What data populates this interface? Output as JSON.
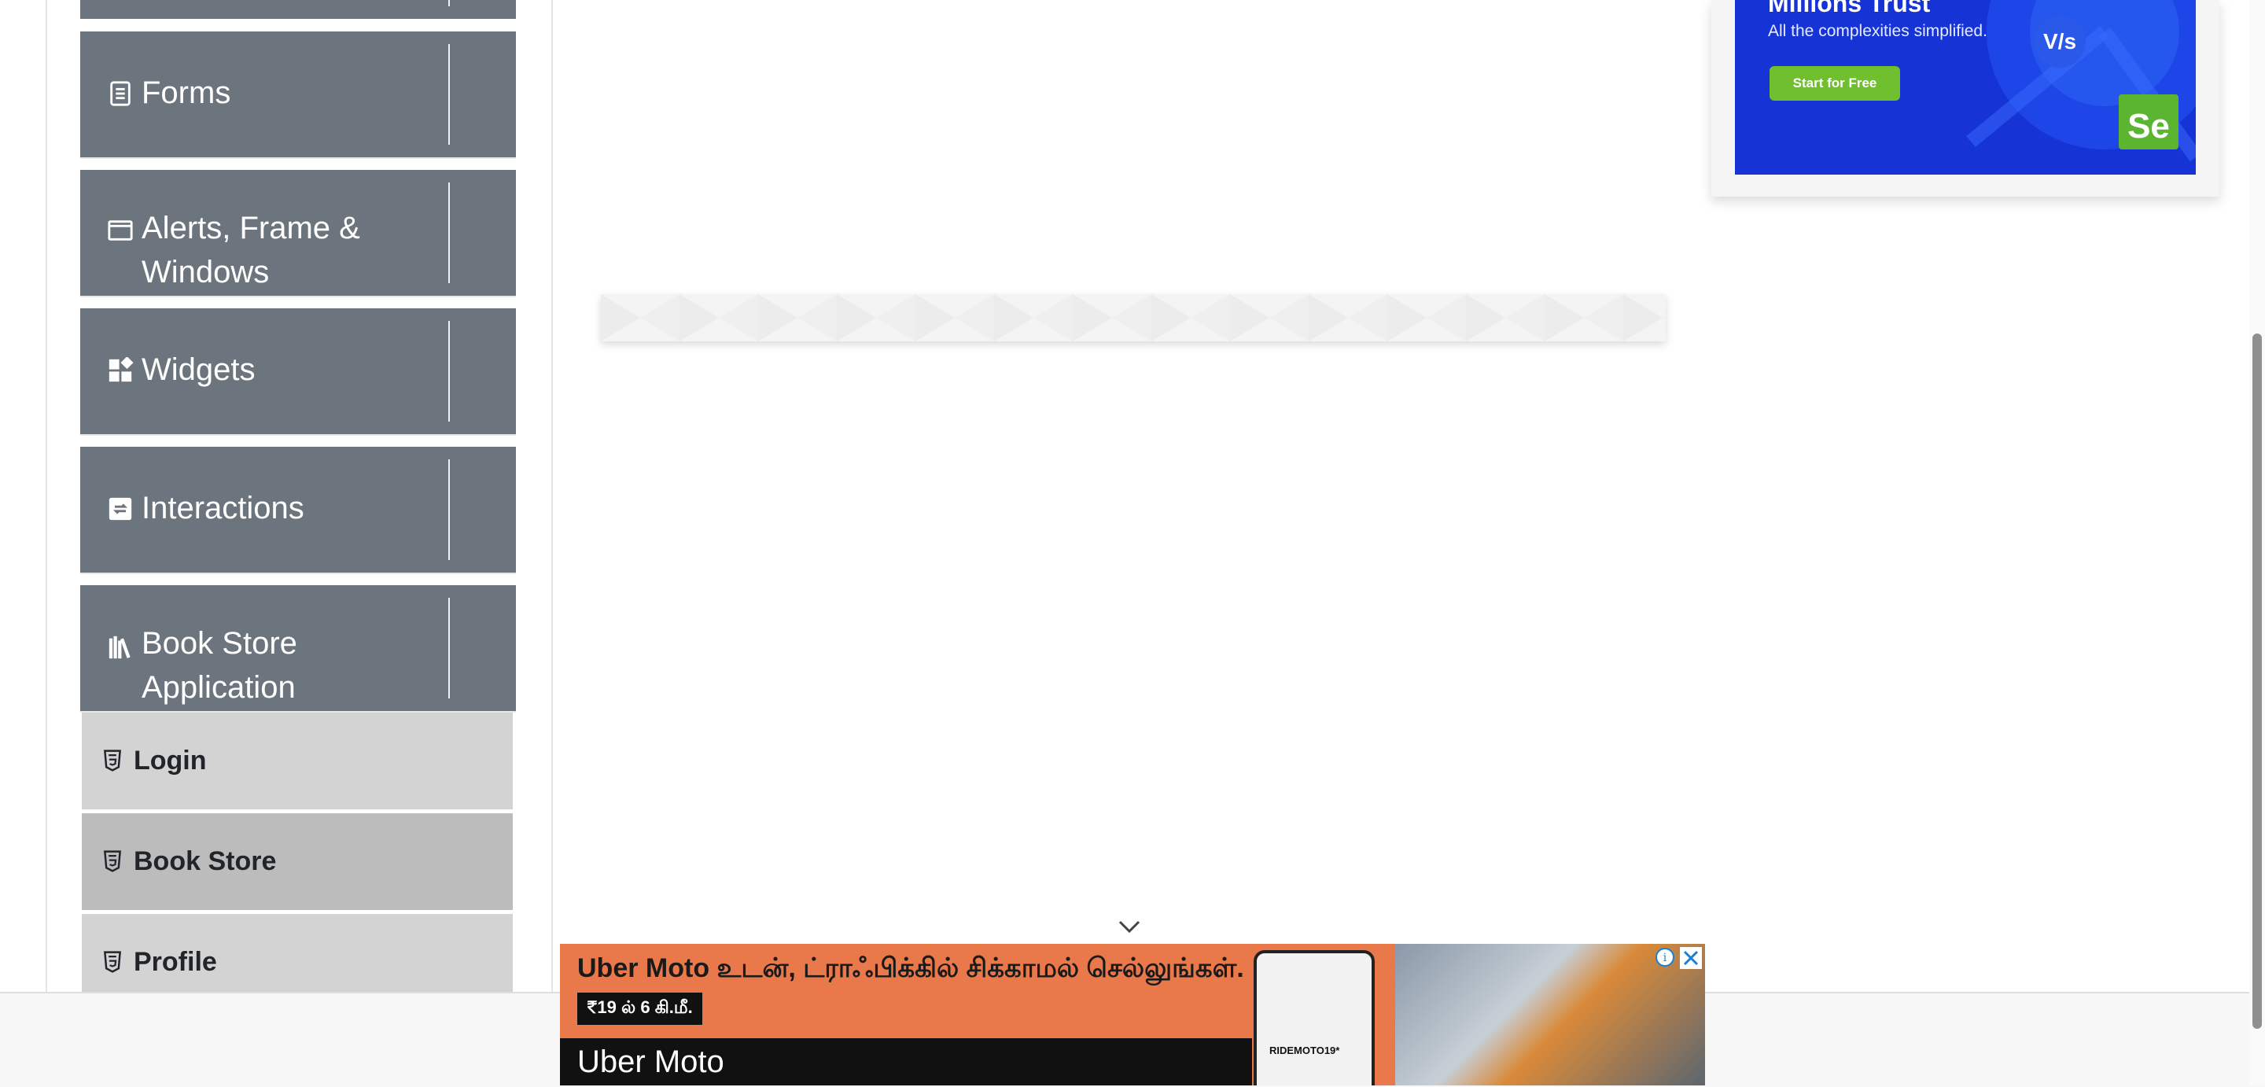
{
  "sidebar": {
    "groups": [
      {
        "title": "Forms",
        "icon": "document-icon",
        "toggle": "expand-arrow"
      },
      {
        "title": "Alerts, Frame & Windows",
        "title_lines": [
          "Alerts, Frame &",
          "Windows"
        ],
        "icon": "window-icon",
        "toggle": "expand-arrow"
      },
      {
        "title": "Widgets",
        "icon": "widgets-icon",
        "toggle": "expand-arrow"
      },
      {
        "title": "Interactions",
        "icon": "interactions-icon",
        "toggle": "expand-arrow"
      },
      {
        "title": "Book Store Application",
        "title_lines": [
          "Book Store",
          "Application"
        ],
        "icon": "books-icon",
        "toggle": "collapse-arrow"
      }
    ],
    "book_store_items": [
      {
        "label": "Login",
        "icon": "html5-icon",
        "bg": "#d3d3d3"
      },
      {
        "label": "Book Store",
        "icon": "html5-icon",
        "bg": "#bcbcbc"
      },
      {
        "label": "Profile",
        "icon": "html5-icon",
        "bg": "#d3d3d3"
      }
    ]
  },
  "right_ad": {
    "title": "Millions Trust",
    "subtitle": "All the complexities simplified.",
    "button_label": "Start for Free",
    "badge_vs": "V/s",
    "badge_se": "Se",
    "bg_color": "#1633d6"
  },
  "bottom_ad": {
    "headline": "Uber Moto உடன், ட்ராஃபிக்கில் சிக்காமல் செல்லுங்கள்.",
    "price": "₹19 ல் 6 கி.மீ.",
    "brand": "Uber Moto",
    "phone_caption": "RIDEMOTO19*",
    "bg_color": "#e9794a"
  },
  "colors": {
    "group_header_bg": "#6c757d",
    "accent": "#6c757d"
  }
}
